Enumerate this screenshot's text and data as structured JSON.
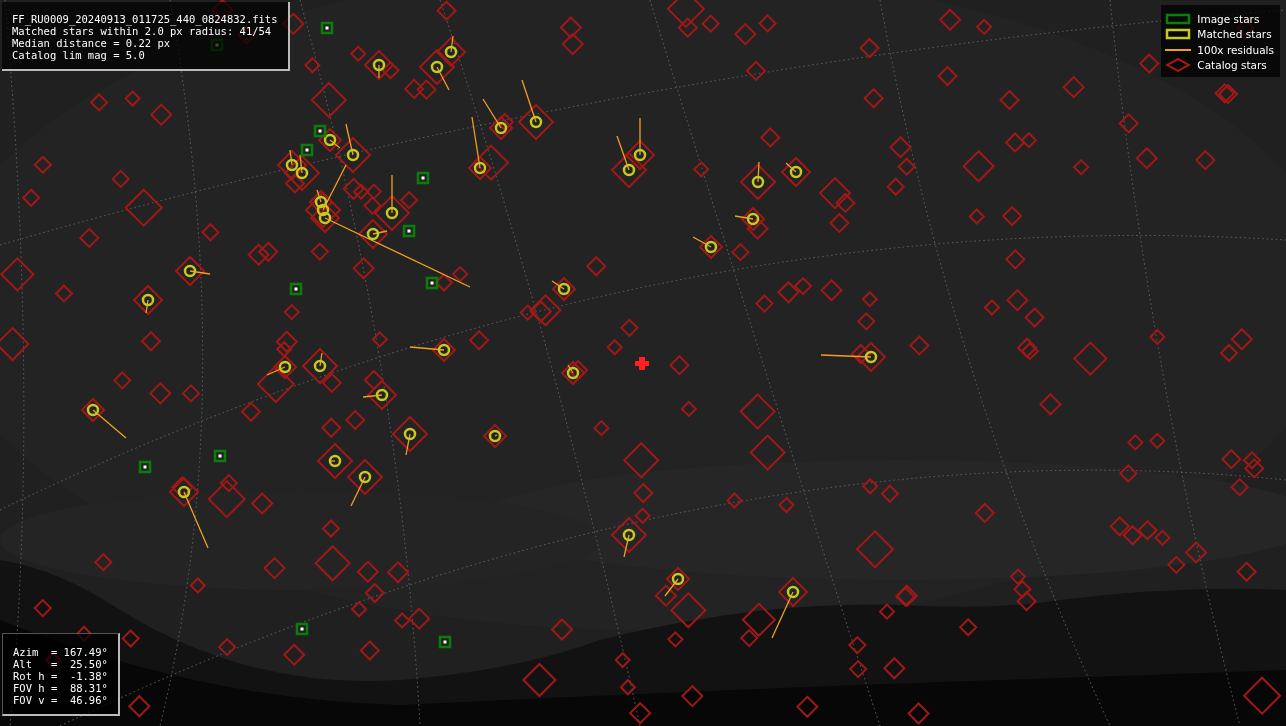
{
  "file_info": {
    "lines": [
      "FF_RU0009_20240913_011725_440_0824832.fits",
      "Matched stars within 2.0 px radius: 41/54",
      "Median distance = 0.22 px",
      "Catalog lim mag = 5.0"
    ]
  },
  "legend": {
    "items": [
      {
        "kind": "box",
        "label": "Image stars",
        "color": "#0b7d0b"
      },
      {
        "kind": "box",
        "label": "Matched stars",
        "color": "#c8c81e"
      },
      {
        "kind": "line",
        "label": "100x residuals",
        "color": "#f0a020"
      },
      {
        "kind": "diamond",
        "label": "Catalog stars",
        "color": "#a01818"
      }
    ]
  },
  "pointing": {
    "lines": [
      "Azim  = 167.49°",
      "Alt   =  25.50°",
      "Rot h =  -1.38°",
      "FOV h =  88.31°",
      "FOV v =  46.96°"
    ]
  }
}
